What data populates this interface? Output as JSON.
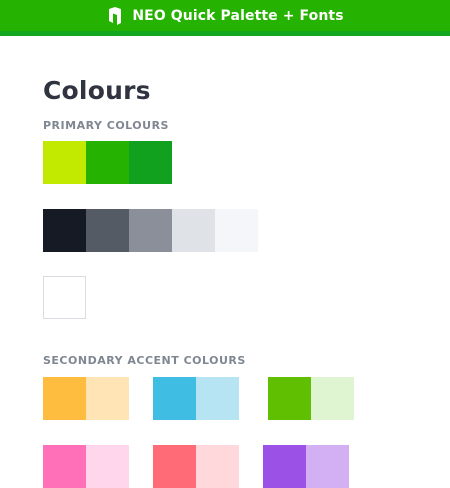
{
  "app": {
    "title": "NEO Quick Palette + Fonts",
    "icon": "neo-logo-icon"
  },
  "main": {
    "heading": "Colours",
    "primary_label": "PRIMARY COLOURS",
    "secondary_label": "SECONDARY ACCENT COLOURS"
  },
  "palette": {
    "primary": [
      "#c1ea00",
      "#25b200",
      "#12a11f"
    ],
    "neutral": [
      "#151a24",
      "#555b64",
      "#8a8f99",
      "#dfe2e6",
      "#f4f6f9"
    ],
    "white": "#ffffff",
    "secondary_pairs": [
      [
        "#ffbd3f",
        "#ffe4b6"
      ],
      [
        "#3fbde3",
        "#b7e4f3"
      ],
      [
        "#60bf00",
        "#dff4d1"
      ],
      [
        "#ff70b9",
        "#ffd6eb"
      ],
      [
        "#ff6b77",
        "#ffd8dc"
      ],
      [
        "#9b50e6",
        "#d2b0f3"
      ]
    ]
  }
}
